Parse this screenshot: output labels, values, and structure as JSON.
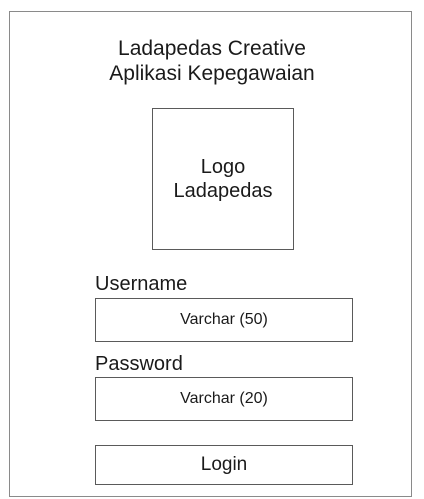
{
  "header": {
    "title_line_1": "Ladapedas Creative",
    "title_line_2": "Aplikasi Kepegawaian"
  },
  "logo": {
    "line_1": "Logo",
    "line_2": "Ladapedas"
  },
  "form": {
    "username_label": "Username",
    "username_value": "Varchar (50)",
    "password_label": "Password",
    "password_value": "Varchar (20)",
    "login_label": "Login"
  }
}
